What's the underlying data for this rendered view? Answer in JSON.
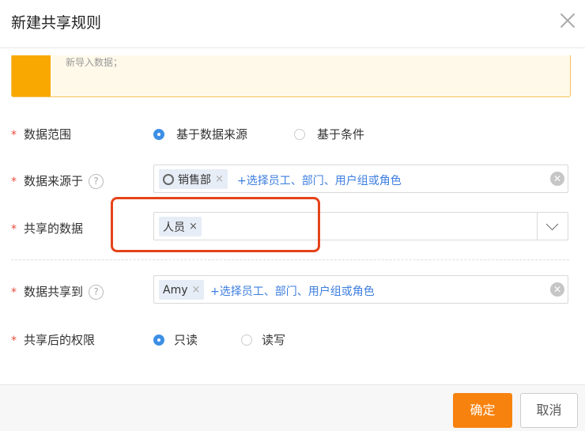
{
  "dialog": {
    "title": "新建共享规则",
    "notice": "新导入数据；"
  },
  "form": {
    "scope": {
      "label": "数据范围",
      "options": [
        "基于数据来源",
        "基于条件"
      ],
      "selected": "基于数据来源"
    },
    "source": {
      "label": "数据来源于",
      "help": "?",
      "chip": "销售部",
      "chip_remove": "×",
      "add_link": "+选择员工、部门、用户组或角色",
      "clear": "✕"
    },
    "shared_data": {
      "label": "共享的数据",
      "chip": "人员",
      "chip_remove": "×"
    },
    "share_to": {
      "label": "数据共享到",
      "help": "?",
      "chip": "Amy",
      "chip_remove": "×",
      "add_link": "+选择员工、部门、用户组或角色",
      "clear": "✕"
    },
    "permission": {
      "label": "共享后的权限",
      "options": [
        "只读",
        "读写"
      ],
      "selected": "只读"
    },
    "required_mark": "*"
  },
  "footer": {
    "ok": "确定",
    "cancel": "取消"
  },
  "colors": {
    "accent": "#f8820e",
    "link": "#3d7ee0",
    "radio": "#3d8fe5",
    "highlight": "#e5431a"
  }
}
